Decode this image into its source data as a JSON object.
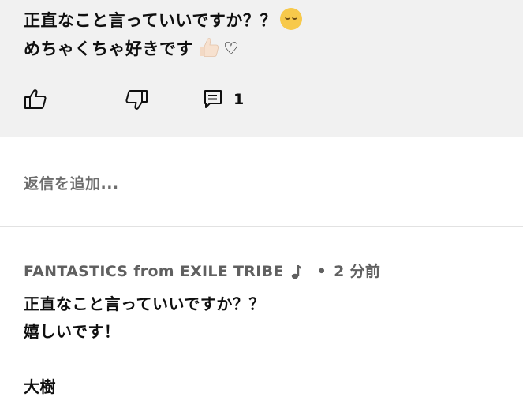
{
  "parent_comment": {
    "line1": "正直なこと言っていいですか？？",
    "line1_emoji": "face-exhaling-emoji",
    "line2": "めちゃくちゃ好きです",
    "line2_emoji": "thumbs-up-light-skin-emoji",
    "line2_suffix": "♡",
    "reply_count": "1"
  },
  "add_reply": {
    "placeholder": "返信を追加..."
  },
  "reply": {
    "author": "FANTASTICS from EXILE TRIBE",
    "author_badge": "music-note-icon",
    "separator": "•",
    "time": "2 分前",
    "lines": [
      "正直なこと言っていいですか？？",
      "嬉しいです！",
      "",
      "大樹"
    ]
  },
  "colors": {
    "highlight_bg": "#f1f1f1",
    "text": "#0f0f0f",
    "secondary_text": "#606060",
    "placeholder_text": "#6d6d6d",
    "divider": "#e2e2e2"
  }
}
